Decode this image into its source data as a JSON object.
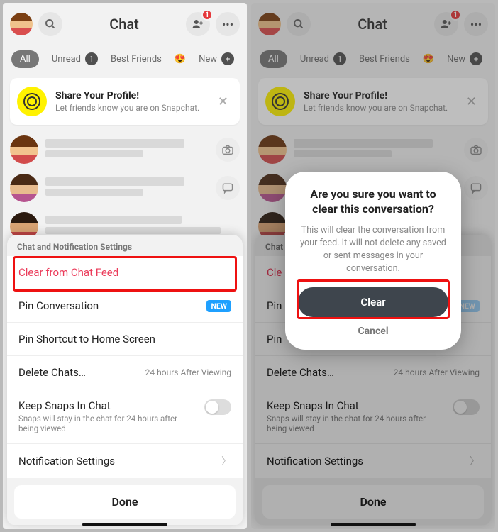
{
  "header": {
    "title": "Chat",
    "notification_count": "1"
  },
  "filters": {
    "all": "All",
    "unread_label": "Unread",
    "unread_count": "1",
    "best_friends": "Best Friends",
    "emoji": "😍",
    "new_label": "New",
    "new_plus": "+"
  },
  "share": {
    "title": "Share Your Profile!",
    "subtitle": "Let friends know you are on Snapchat."
  },
  "sheet": {
    "header": "Chat and Notification Settings",
    "clear": "Clear from Chat Feed",
    "pin": "Pin Conversation",
    "new_badge": "NEW",
    "pin_home": "Pin Shortcut to Home Screen",
    "delete": "Delete Chats…",
    "delete_time": "24 hours After Viewing",
    "keep": "Keep Snaps In Chat",
    "keep_sub": "Snaps will stay in the chat for 24 hours after being viewed",
    "notif": "Notification Settings",
    "done": "Done"
  },
  "sheet2": {
    "clear_short": "Cle",
    "pin_short": "Pin",
    "pinhome_short": "Pin"
  },
  "alert": {
    "title": "Are you sure you want to clear this conversation?",
    "body": "This will clear the conversation from your feed. It will not delete any saved or sent messages in your conversation.",
    "clear": "Clear",
    "cancel": "Cancel"
  }
}
